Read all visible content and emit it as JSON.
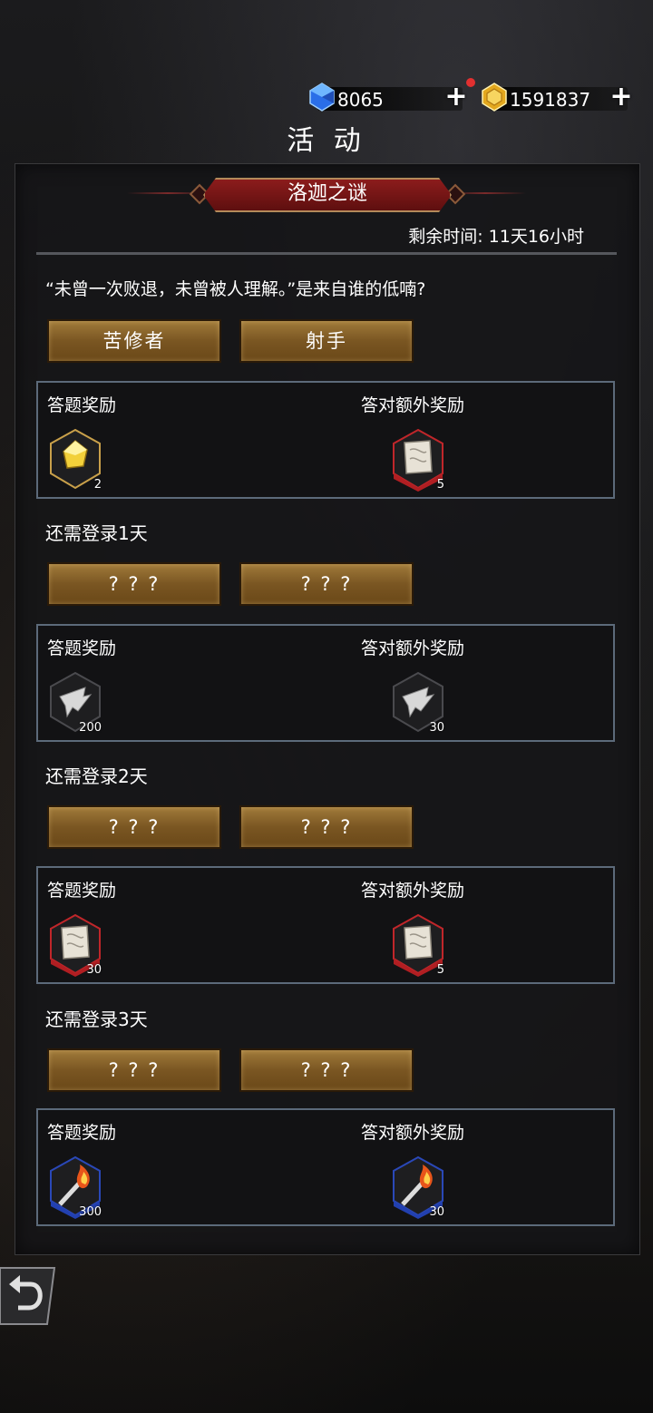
{
  "currencies": {
    "gem": {
      "icon": "blue-gem-icon",
      "value": "8065"
    },
    "gold": {
      "icon": "gold-coin-icon",
      "value": "1591837"
    }
  },
  "page_title": "活 动",
  "event": {
    "title": "洛迦之谜",
    "remaining": "剩余时间: 11天16小时"
  },
  "quiz": {
    "question": "“未曾一次败退，未曾被人理解。”是来自谁的低喃?",
    "answers": [
      "苦修者",
      "射手"
    ],
    "reward_label": "答题奖励",
    "bonus_label": "答对额外奖励",
    "reward": {
      "icon": "gold-crystal-icon",
      "count": "2"
    },
    "bonus": {
      "icon": "parchment-scroll-icon",
      "count": "5"
    }
  },
  "locked": [
    {
      "label": "还需登录1天",
      "answers": [
        "? ? ?",
        "? ? ?"
      ],
      "reward_label": "答题奖励",
      "bonus_label": "答对额外奖励",
      "reward": {
        "icon": "wing-shard-icon",
        "count": "200"
      },
      "bonus": {
        "icon": "wing-shard-icon",
        "count": "30"
      }
    },
    {
      "label": "还需登录2天",
      "answers": [
        "? ? ?",
        "? ? ?"
      ],
      "reward_label": "答题奖励",
      "bonus_label": "答对额外奖励",
      "reward": {
        "icon": "parchment-scroll-icon",
        "count": "30"
      },
      "bonus": {
        "icon": "parchment-scroll-icon",
        "count": "5"
      }
    },
    {
      "label": "还需登录3天",
      "answers": [
        "? ? ?",
        "? ? ?"
      ],
      "reward_label": "答题奖励",
      "bonus_label": "答对额外奖励",
      "reward": {
        "icon": "torch-icon",
        "count": "300"
      },
      "bonus": {
        "icon": "torch-icon",
        "count": "30"
      }
    }
  ],
  "back": {
    "icon": "back-arrow-icon"
  }
}
